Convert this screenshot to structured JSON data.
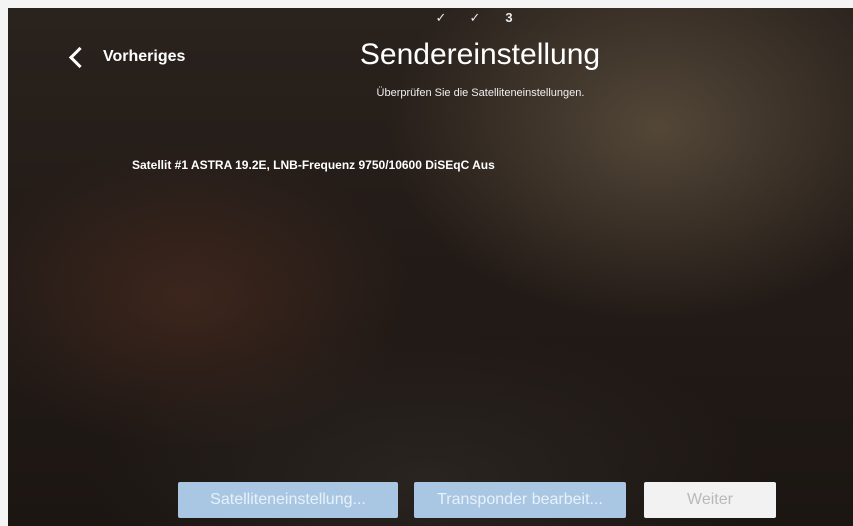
{
  "progress": {
    "steps": [
      "✓",
      "✓",
      "3"
    ]
  },
  "nav": {
    "back_label": "Vorheriges"
  },
  "header": {
    "title": "Sendereinstellung",
    "subtitle": "Überprüfen Sie die Satelliteneinstellungen."
  },
  "main": {
    "satellite_info": "Satellit #1 ASTRA 19.2E, LNB-Frequenz 9750/10600 DiSEqC Aus"
  },
  "buttons": {
    "satellite_settings": "Satelliteneinstellung...",
    "edit_transponder": "Transponder bearbeit...",
    "next": "Weiter"
  },
  "colors": {
    "button_active": "#a9c7e2",
    "button_next": "#f2f2f2",
    "background": "#231b17"
  }
}
